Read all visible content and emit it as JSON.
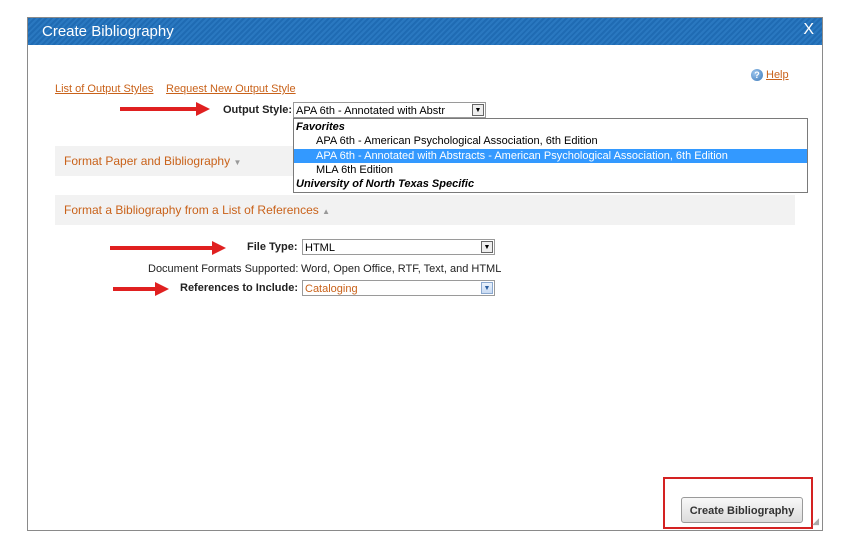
{
  "dialog": {
    "title": "Create Bibliography",
    "close_label": "X"
  },
  "links": {
    "list_output_styles": "List of Output Styles",
    "request_new_style": "Request New Output Style",
    "help": "Help"
  },
  "output_style": {
    "label": "Output Style:",
    "value": "APA 6th - Annotated with Abstr",
    "options": [
      {
        "text": "Favorites",
        "type": "group"
      },
      {
        "text": "APA 6th - American Psychological Association, 6th Edition",
        "type": "item"
      },
      {
        "text": "APA 6th - Annotated with Abstracts - American Psychological Association, 6th Edition",
        "type": "item",
        "selected": true
      },
      {
        "text": "MLA 6th Edition",
        "type": "item"
      },
      {
        "text": "University of North Texas Specific",
        "type": "group"
      }
    ]
  },
  "sections": {
    "format_paper": "Format Paper and Bibliography",
    "format_list": "Format a Bibliography from a List of References"
  },
  "file_type": {
    "label": "File Type:",
    "value": "HTML"
  },
  "formats": {
    "label": "Document Formats Supported:",
    "value": "Word, Open Office, RTF, Text, and HTML"
  },
  "references": {
    "label": "References to Include:",
    "value": "Cataloging"
  },
  "actions": {
    "create_bibliography": "Create Bibliography"
  },
  "colors": {
    "title_bar": "#1f6bb3",
    "link": "#c9621a",
    "selection": "#3399ff",
    "annotation": "#e02020"
  }
}
